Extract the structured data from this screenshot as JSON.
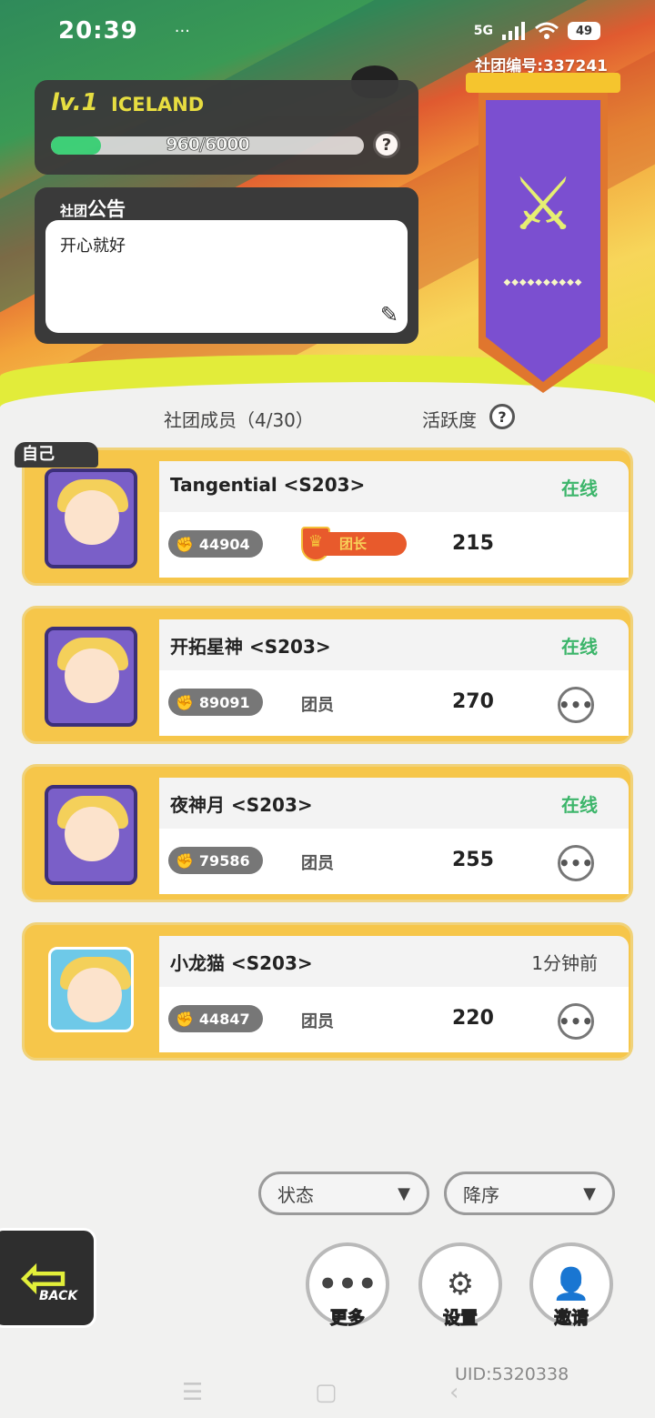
{
  "status_bar": {
    "time": "20:39",
    "more": "···",
    "network": "5G",
    "battery": "49"
  },
  "club": {
    "id_text": "社团编号:337241",
    "level_prefix": "lv.1",
    "name": "ICELAND",
    "xp_text": "960/6000",
    "xp_progress": 0.16,
    "help": "?"
  },
  "notice": {
    "title_small": "社团",
    "title_big": "公告",
    "content": "开心就好",
    "edit_icon": "✎"
  },
  "banner": {
    "emblem": "⚔",
    "dots": "◆◆◆◆◆◆◆◆◆◆"
  },
  "header": {
    "members_label": "社团成员（4/30）",
    "activity_label": "活跃度"
  },
  "self_tag": "自己",
  "members": [
    {
      "name": "Tangential <S203>",
      "status": "在线",
      "status_type": "online",
      "power": "44904",
      "role": "团长",
      "is_leader": true,
      "score": "215"
    },
    {
      "name": "开拓星神 <S203>",
      "status": "在线",
      "status_type": "online",
      "power": "89091",
      "role": "团员",
      "is_leader": false,
      "score": "270"
    },
    {
      "name": "夜神月 <S203>",
      "status": "在线",
      "status_type": "online",
      "power": "79586",
      "role": "团员",
      "is_leader": false,
      "score": "255"
    },
    {
      "name": "小龙猫 <S203>",
      "status": "1分钟前",
      "status_type": "offline",
      "power": "44847",
      "role": "团员",
      "is_leader": false,
      "score": "220"
    }
  ],
  "filters": {
    "status_label": "状态",
    "order_label": "降序"
  },
  "back": {
    "label": "BACK"
  },
  "actions": {
    "more_label": "更多",
    "settings_label": "设置",
    "invite_label": "邀请"
  },
  "uid": "UID:5320338",
  "colors": {
    "online": "#3cb56a",
    "card": "#f6c64a",
    "accent": "#e2ec3a"
  }
}
